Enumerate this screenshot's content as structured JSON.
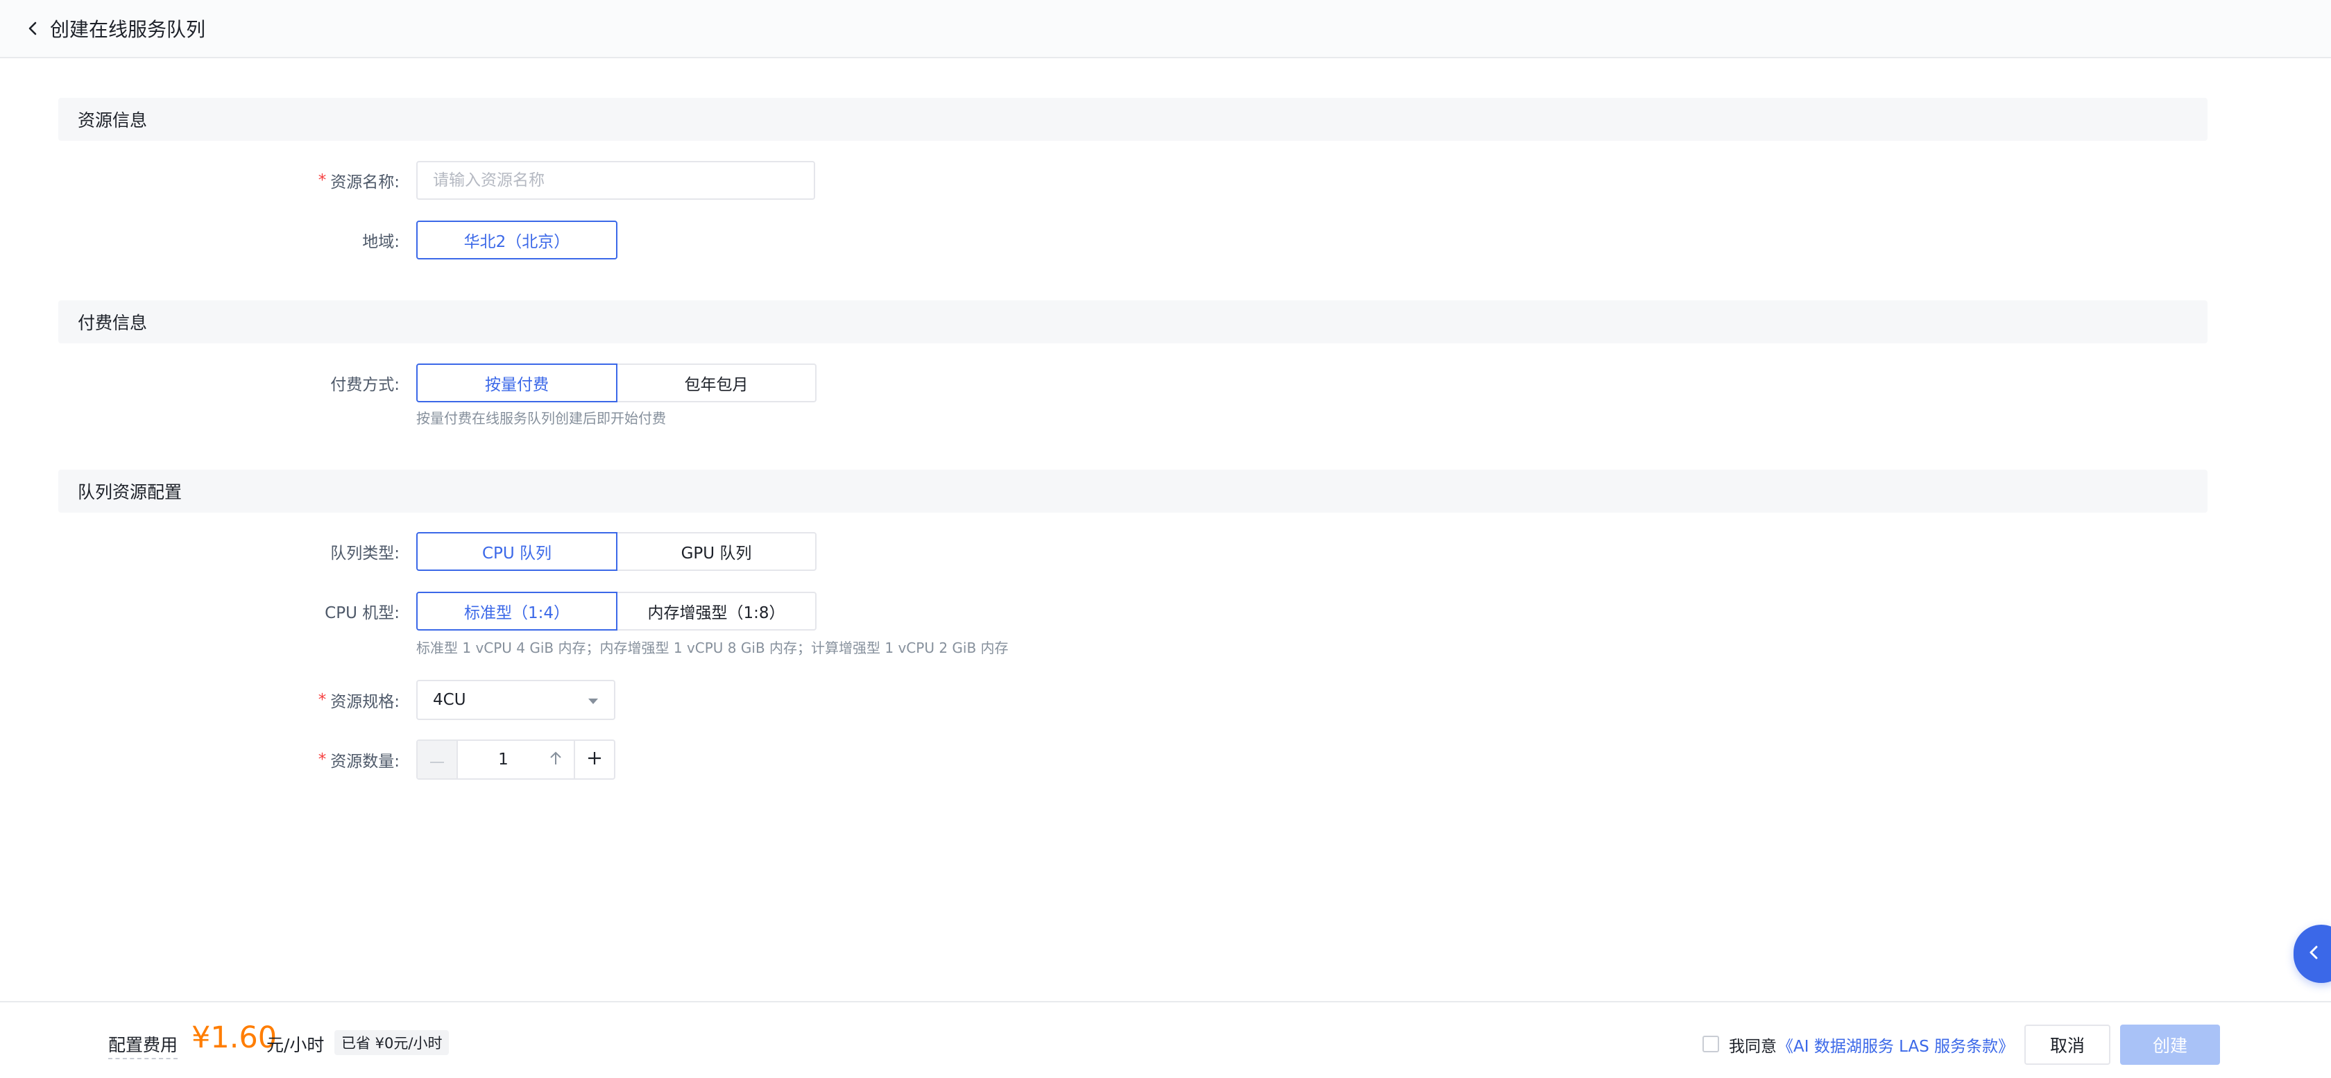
{
  "header": {
    "title": "创建在线服务队列"
  },
  "sections": {
    "resource": "资源信息",
    "billing": "付费信息",
    "queue": "队列资源配置"
  },
  "form": {
    "resource_name": {
      "label": "资源名称:",
      "placeholder": "请输入资源名称",
      "value": ""
    },
    "region": {
      "label": "地域:",
      "selected": "华北2（北京）"
    },
    "billing_method": {
      "label": "付费方式:",
      "options": [
        "按量付费",
        "包年包月"
      ],
      "selected": "按量付费",
      "hint": "按量付费在线服务队列创建后即开始付费"
    },
    "queue_type": {
      "label": "队列类型:",
      "options": [
        "CPU 队列",
        "GPU 队列"
      ],
      "selected": "CPU 队列"
    },
    "cpu_model": {
      "label": "CPU 机型:",
      "options": [
        "标准型（1:4）",
        "内存增强型（1:8）"
      ],
      "selected": "标准型（1:4）",
      "hint": "标准型 1 vCPU 4 GiB 内存；内存增强型 1 vCPU 8 GiB 内存；计算增强型 1 vCPU 2 GiB 内存"
    },
    "spec": {
      "label": "资源规格:",
      "value": "4CU"
    },
    "quantity": {
      "label": "资源数量:",
      "value": "1"
    }
  },
  "footer": {
    "fee_label": "配置费用",
    "fee_amount": "¥1.60",
    "fee_unit": "元/小时",
    "saved": "已省 ¥0元/小时",
    "agree_prefix": "我同意",
    "agree_link": "《AI 数据湖服务 LAS 服务条款》",
    "cancel": "取消",
    "create": "创建"
  },
  "colors": {
    "accent": "#3b68e8",
    "price": "#ff7d00",
    "required": "#f53f3f",
    "create_disabled": "#a9c2f7"
  },
  "icons": {
    "back": "chevron-left-icon",
    "caret": "caret-down-icon",
    "minus": "minus-icon",
    "up": "arrow-up-icon",
    "plus": "plus-icon",
    "float": "chevron-left-icon"
  }
}
